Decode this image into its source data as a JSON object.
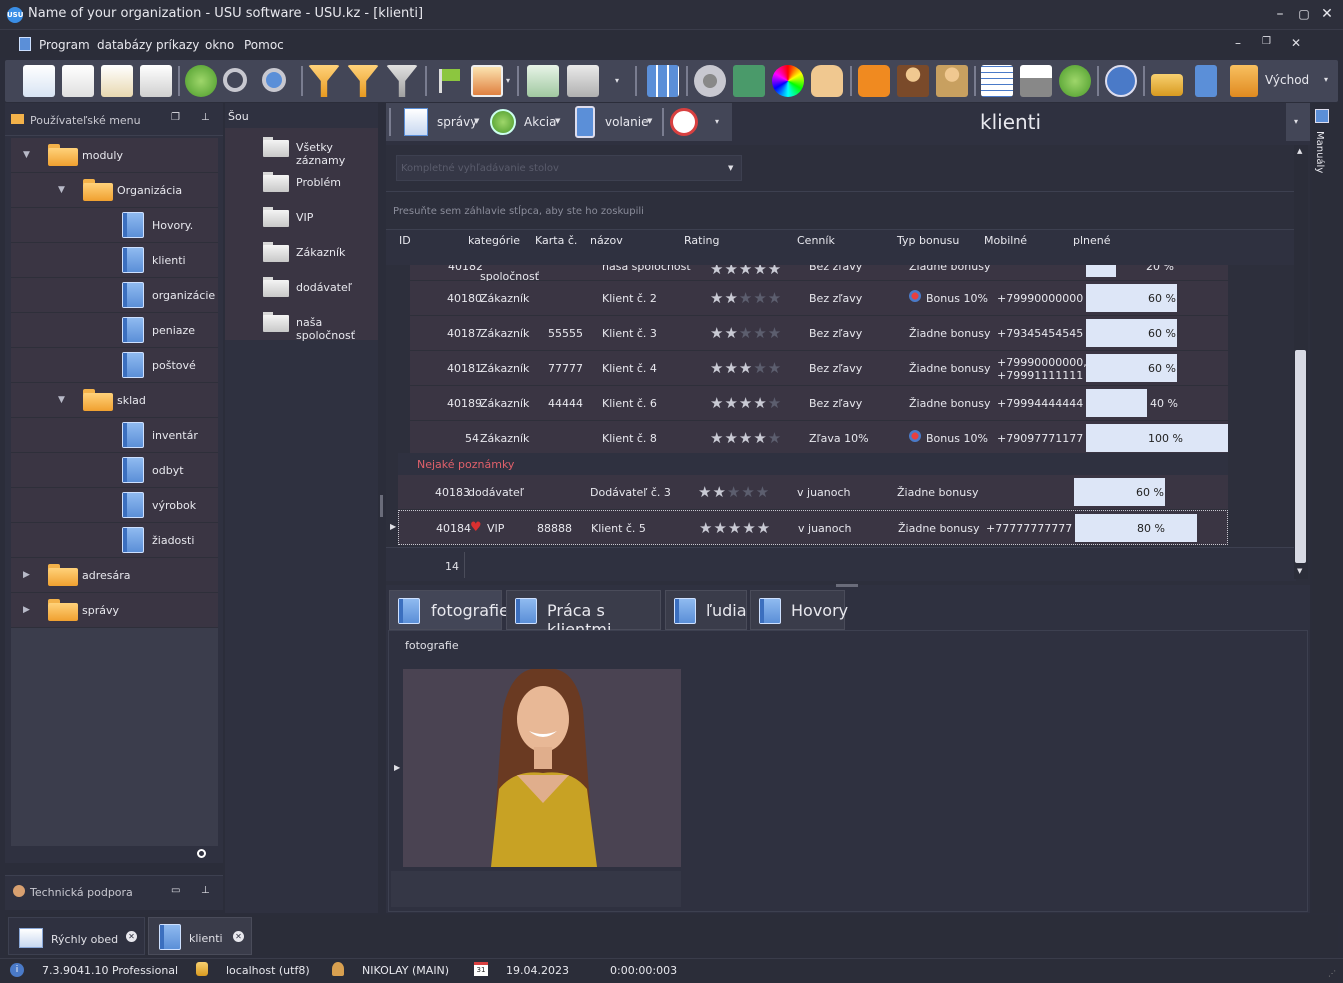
{
  "window": {
    "title": "Name of your organization - USU software - USU.kz - [klienti]",
    "app_icon": "USU"
  },
  "menu": {
    "items": [
      "Program",
      "databázy",
      "príkazy",
      "okno",
      "Pomoc"
    ]
  },
  "toolbar": {
    "exit_label": "Východ"
  },
  "left_panel": {
    "title": "Používateľské menu",
    "tree": {
      "moduly": "moduly",
      "organizacia": "Organizácia",
      "org_items": [
        "Hovory.",
        "klienti",
        "organizácie",
        "peniaze",
        "poštové"
      ],
      "sklad": "sklad",
      "sklad_items": [
        "inventár",
        "odbyt",
        "výrobok",
        "žiadosti"
      ],
      "adresara": "adresára",
      "spravy": "správy"
    },
    "support_title": "Technická podpora"
  },
  "sou_panel": {
    "title": "Šou",
    "items": [
      "Všetky záznamy",
      "Problém",
      "VIP",
      "Zákazník",
      "dodávateľ",
      "naša spoločnosť"
    ]
  },
  "subtoolbar": {
    "spravy": "správy",
    "akcia": "Akcia",
    "volanie": "volanie"
  },
  "view_title": "klienti",
  "grid": {
    "search_placeholder": "Kompletné vyhľadávanie stolov",
    "group_hint": "Presuňte sem záhlavie stĺpca, aby ste ho zoskupili",
    "columns": [
      "ID",
      "kategórie",
      "Karta č.",
      "názov",
      "Rating",
      "Cenník",
      "Typ bonusu",
      "Mobilné",
      "plnené"
    ],
    "partial_row": {
      "id": "40182",
      "category": "spoločnosť",
      "name": "naša spoločnosť",
      "pricelist": "Bez zľavy",
      "bonus": "Žiadne bonusy",
      "progress": "20 %"
    },
    "rows": [
      {
        "id": "40180",
        "category": "Zákazník",
        "card": "",
        "name": "Klient č. 2",
        "rating": 2,
        "pricelist": "Bez zľavy",
        "bonus": "Bonus 10%",
        "mobile": "+79990000000",
        "progress": "60 %",
        "fill": 0.6
      },
      {
        "id": "40187",
        "category": "Zákazník",
        "card": "55555",
        "name": "Klient č. 3",
        "rating": 2,
        "pricelist": "Bez zľavy",
        "bonus": "Žiadne bonusy",
        "mobile": "+79345454545",
        "progress": "60 %",
        "fill": 0.6
      },
      {
        "id": "40181",
        "category": "Zákazník",
        "card": "77777",
        "name": "Klient č. 4",
        "rating": 3,
        "pricelist": "Bez zľavy",
        "bonus": "Žiadne bonusy",
        "mobile": "+79990000000,",
        "mobile2": "+79991111111",
        "progress": "60 %",
        "fill": 0.6
      },
      {
        "id": "40189",
        "category": "Zákazník",
        "card": "44444",
        "name": "Klient č. 6",
        "rating": 4,
        "pricelist": "Bez zľavy",
        "bonus": "Žiadne bonusy",
        "mobile": "+79994444444",
        "progress": "40 %",
        "fill": 0.4
      },
      {
        "id": "54",
        "category": "Zákazník",
        "card": "",
        "name": "Klient č. 8",
        "rating": 4,
        "pricelist": "Zľava 10%",
        "bonus": "Bonus 10%",
        "mobile": "+79097771177",
        "progress": "100 %",
        "fill": 1.0
      }
    ],
    "group_label": "Nejaké poznámky",
    "rows2": [
      {
        "id": "40183",
        "category": "dodávateľ",
        "card": "",
        "name": "Dodávateľ č. 3",
        "rating": 2,
        "pricelist": "v juanoch",
        "bonus": "Žiadne bonusy",
        "mobile": "",
        "progress": "60 %",
        "fill": 0.6
      },
      {
        "id": "40184",
        "category": "VIP",
        "card": "88888",
        "name": "Klient č. 5",
        "rating": 5,
        "pricelist": "v juanoch",
        "bonus": "Žiadne bonusy",
        "mobile": "+77777777777",
        "progress": "80 %",
        "fill": 0.8
      }
    ],
    "count": "14"
  },
  "tabs": [
    "fotografie",
    "Práca s klientmi",
    "ľudia",
    "Hovory"
  ],
  "photo_label": "fotografie",
  "right_strip": {
    "label": "Manuály"
  },
  "bottom_tabs": [
    "Rýchly obed",
    "klienti"
  ],
  "status": {
    "version": "7.3.9041.10 Professional",
    "db": "localhost (utf8)",
    "user": "NIKOLAY (MAIN)",
    "date": "19.04.2023",
    "timer": "0:00:00:003",
    "calendar_day": "31"
  }
}
